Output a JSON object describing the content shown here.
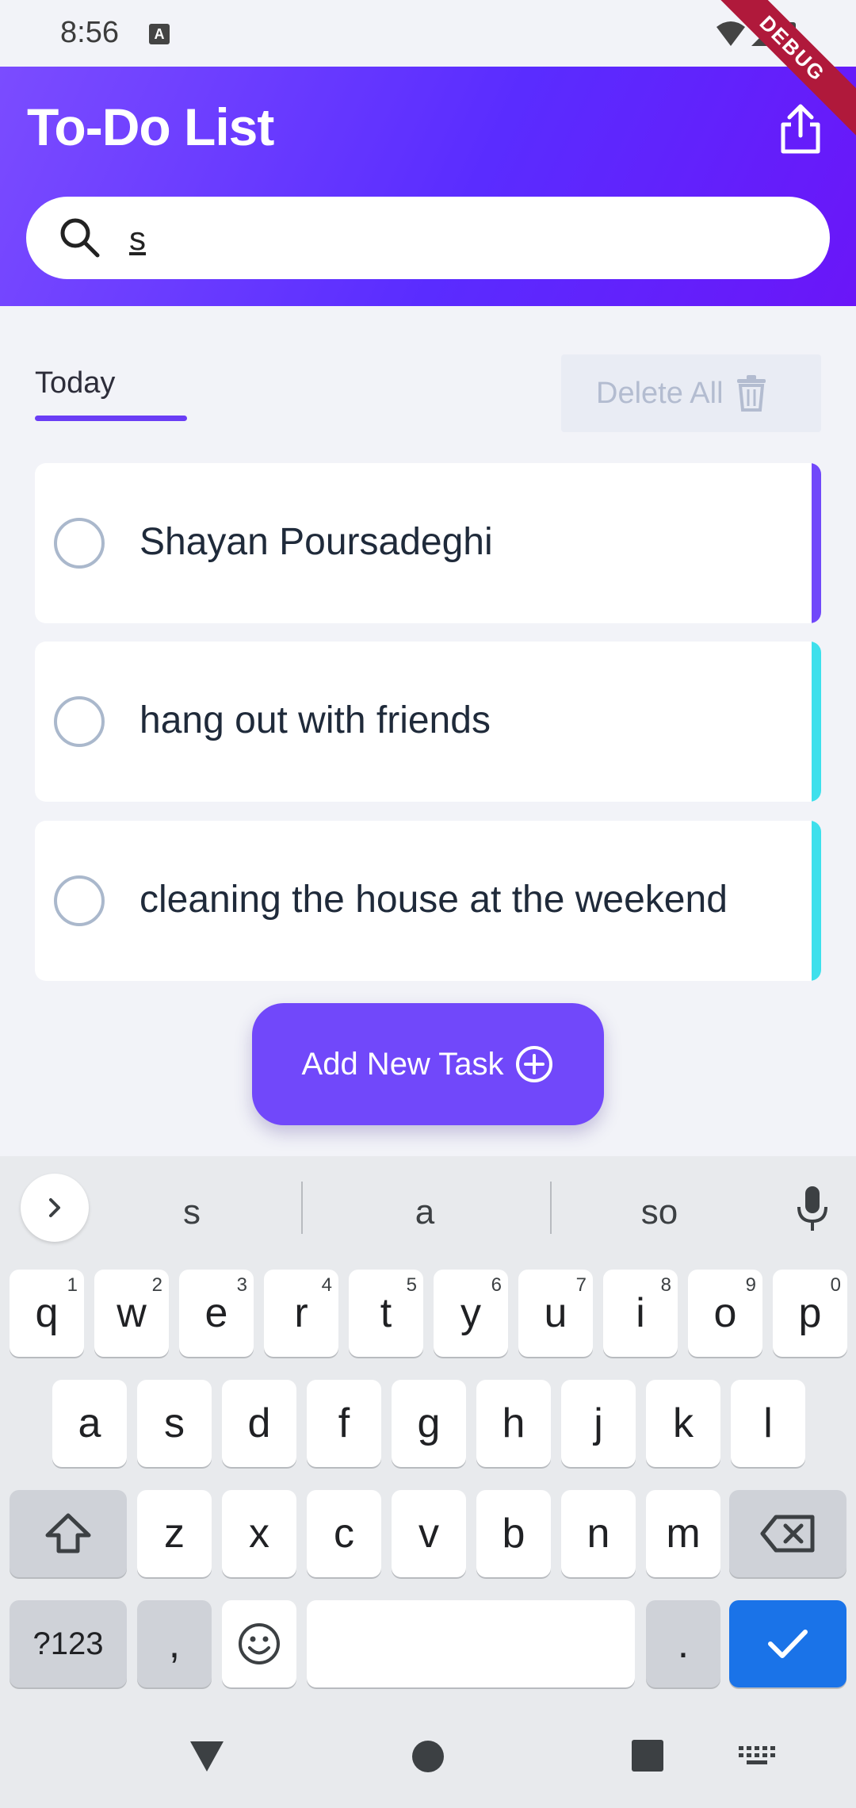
{
  "status_bar": {
    "time": "8:56",
    "notification_badge": "A",
    "debug_ribbon": "DEBUG"
  },
  "header": {
    "title": "To-Do List",
    "share_icon": "share-icon",
    "search_value": "s"
  },
  "tabs": {
    "active": "Today"
  },
  "delete_all": {
    "label": "Delete All"
  },
  "tasks": [
    {
      "title": "Shayan Poursadeghi",
      "accent": "#7148fa"
    },
    {
      "title": "hang out with friends",
      "accent": "#3ee0ec"
    },
    {
      "title": "cleaning the house at the weekend",
      "accent": "#3ee0ec"
    }
  ],
  "add_button": {
    "label": "Add New Task"
  },
  "keyboard": {
    "suggestions": [
      "s",
      "a",
      "so"
    ],
    "row1": [
      {
        "k": "q",
        "h": "1"
      },
      {
        "k": "w",
        "h": "2"
      },
      {
        "k": "e",
        "h": "3"
      },
      {
        "k": "r",
        "h": "4"
      },
      {
        "k": "t",
        "h": "5"
      },
      {
        "k": "y",
        "h": "6"
      },
      {
        "k": "u",
        "h": "7"
      },
      {
        "k": "i",
        "h": "8"
      },
      {
        "k": "o",
        "h": "9"
      },
      {
        "k": "p",
        "h": "0"
      }
    ],
    "row2": [
      "a",
      "s",
      "d",
      "f",
      "g",
      "h",
      "j",
      "k",
      "l"
    ],
    "row3": [
      "z",
      "x",
      "c",
      "v",
      "b",
      "n",
      "m"
    ],
    "symbols_label": "?123",
    "comma": ",",
    "period": "."
  },
  "colors": {
    "accent": "#7148fa",
    "enter": "#1a73e8"
  }
}
